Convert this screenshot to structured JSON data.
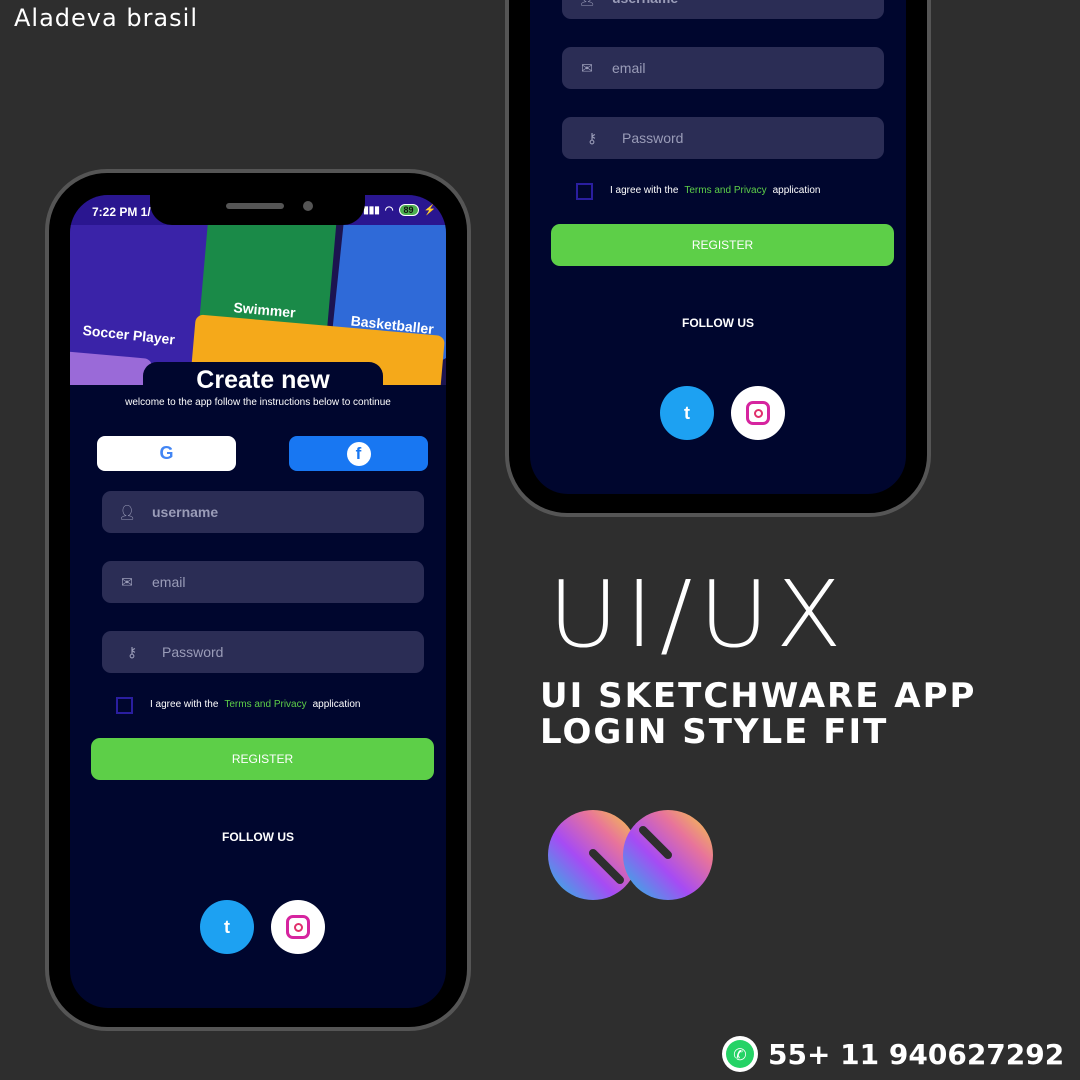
{
  "brand": "Aladeva brasil",
  "status": {
    "time": "7:22 PM 1/",
    "battery": "89"
  },
  "banner": {
    "cards": [
      "Soccer Player",
      "Swimmer",
      "Basketballer"
    ]
  },
  "screen": {
    "title": "Create new",
    "subtitle": "welcome to the app follow the instructions below to continue",
    "google": "G",
    "facebook": "f",
    "username_placeholder": "username",
    "email_placeholder": "email",
    "password_placeholder": "Password",
    "agree_prefix": "I agree with the",
    "agree_link": "Terms and Privacy",
    "agree_suffix": "application",
    "register": "REGISTER",
    "follow": "FOLLOW US",
    "twitter": "t"
  },
  "colors": {
    "accent": "#5dcf48",
    "background": "#00062e",
    "facebook": "#1877f2",
    "twitter": "#1da1f2"
  },
  "promo": {
    "title": "UI/UX",
    "line1": "UI SKETCHWARE APP",
    "line2": "LOGIN STYLE FIT"
  },
  "contact": {
    "phone": "55+ 11 940627292"
  }
}
